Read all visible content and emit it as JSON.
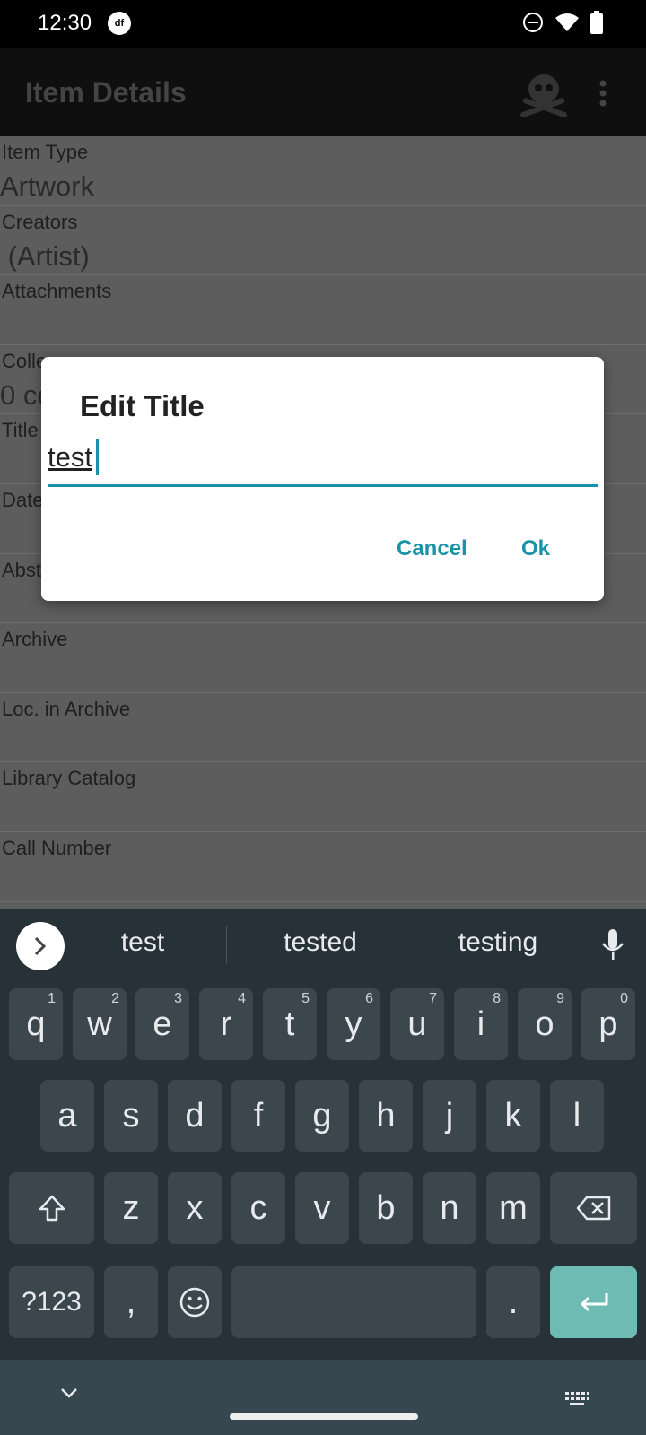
{
  "status_bar": {
    "time": "12:30",
    "app_badge": "df"
  },
  "app_bar": {
    "title": "Item Details"
  },
  "fields": [
    {
      "label": "Item Type",
      "value": "Artwork"
    },
    {
      "label": "Creators",
      "value": " (Artist)"
    },
    {
      "label": "Attachments",
      "value": ""
    },
    {
      "label": "Colle",
      "value": "0 co"
    },
    {
      "label": "Title",
      "value": ""
    },
    {
      "label": "Date",
      "value": ""
    },
    {
      "label": "Abst",
      "value": ""
    },
    {
      "label": "Archive",
      "value": ""
    },
    {
      "label": "Loc. in Archive",
      "value": ""
    },
    {
      "label": "Library Catalog",
      "value": ""
    },
    {
      "label": "Call Number",
      "value": ""
    }
  ],
  "dialog": {
    "title": "Edit Title",
    "input_value": "test",
    "cancel_label": "Cancel",
    "ok_label": "Ok"
  },
  "keyboard": {
    "suggestions": [
      "test",
      "tested",
      "testing"
    ],
    "row1": [
      [
        "q",
        "1"
      ],
      [
        "w",
        "2"
      ],
      [
        "e",
        "3"
      ],
      [
        "r",
        "4"
      ],
      [
        "t",
        "5"
      ],
      [
        "y",
        "6"
      ],
      [
        "u",
        "7"
      ],
      [
        "i",
        "8"
      ],
      [
        "o",
        "9"
      ],
      [
        "p",
        "0"
      ]
    ],
    "row2": [
      "a",
      "s",
      "d",
      "f",
      "g",
      "h",
      "j",
      "k",
      "l"
    ],
    "row3": [
      "z",
      "x",
      "c",
      "v",
      "b",
      "n",
      "m"
    ],
    "symbols_label": "?123",
    "comma": ",",
    "period": "."
  },
  "colors": {
    "accent": "#1a93a8",
    "keyboard_bg": "#263238",
    "key_bg": "#3b474d",
    "enter_key": "#6ebbb3"
  }
}
